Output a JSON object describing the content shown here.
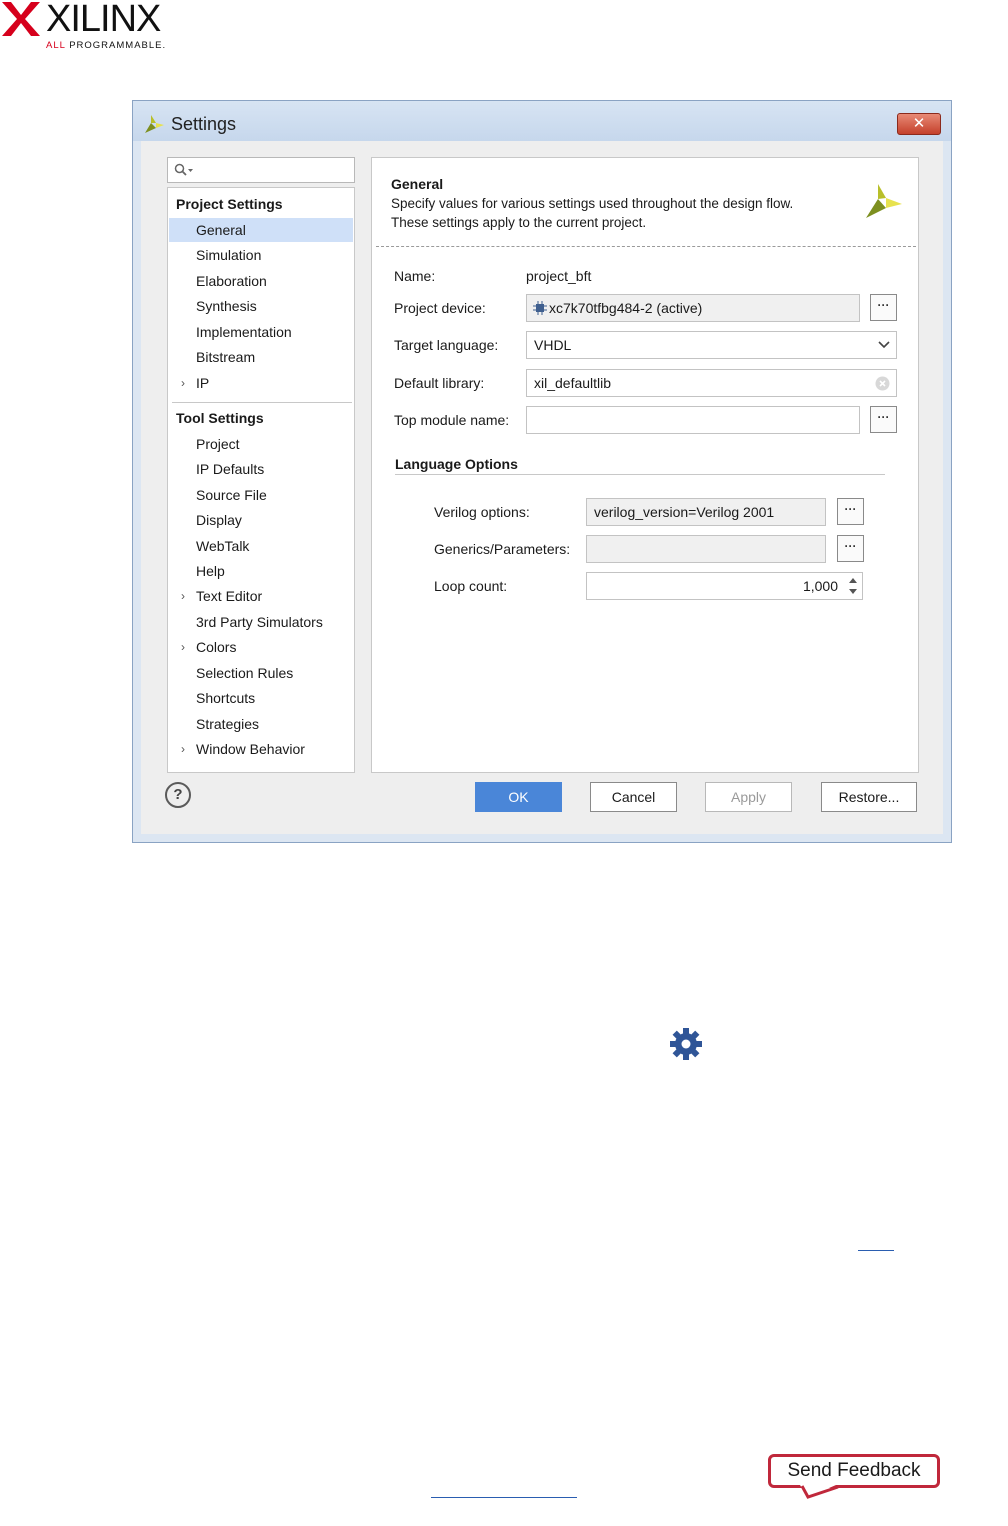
{
  "brand": {
    "name": "XILINX",
    "tagline_highlight": "ALL",
    "tagline_rest": " PROGRAMMABLE."
  },
  "dialog": {
    "title": "Settings",
    "close_glyph": "✕",
    "search_placeholder": "",
    "nav": {
      "project_header": "Project Settings",
      "project_items": [
        {
          "label": "General",
          "selected": true,
          "expandable": false
        },
        {
          "label": "Simulation",
          "selected": false,
          "expandable": false
        },
        {
          "label": "Elaboration",
          "selected": false,
          "expandable": false
        },
        {
          "label": "Synthesis",
          "selected": false,
          "expandable": false
        },
        {
          "label": "Implementation",
          "selected": false,
          "expandable": false
        },
        {
          "label": "Bitstream",
          "selected": false,
          "expandable": false
        },
        {
          "label": "IP",
          "selected": false,
          "expandable": true
        }
      ],
      "tool_header": "Tool Settings",
      "tool_items": [
        {
          "label": "Project",
          "expandable": false
        },
        {
          "label": "IP Defaults",
          "expandable": false
        },
        {
          "label": "Source File",
          "expandable": false
        },
        {
          "label": "Display",
          "expandable": false
        },
        {
          "label": "WebTalk",
          "expandable": false
        },
        {
          "label": "Help",
          "expandable": false
        },
        {
          "label": "Text Editor",
          "expandable": true
        },
        {
          "label": "3rd Party Simulators",
          "expandable": false
        },
        {
          "label": "Colors",
          "expandable": true
        },
        {
          "label": "Selection Rules",
          "expandable": false
        },
        {
          "label": "Shortcuts",
          "expandable": false
        },
        {
          "label": "Strategies",
          "expandable": false
        },
        {
          "label": "Window Behavior",
          "expandable": true
        }
      ]
    },
    "panel": {
      "heading": "General",
      "desc_line1": "Specify values for various settings used throughout the design flow.",
      "desc_line2": "These settings apply to the current project.",
      "name_label": "Name:",
      "name_value": "project_bft",
      "device_label": "Project device:",
      "device_value": "xc7k70tfbg484-2 (active)",
      "language_label": "Target language:",
      "language_value": "VHDL",
      "library_label": "Default library:",
      "library_value": "xil_defaultlib",
      "top_module_label": "Top module name:",
      "top_module_value": "",
      "language_options_heading": "Language Options",
      "verilog_label": "Verilog options:",
      "verilog_value": "verilog_version=Verilog 2001",
      "generics_label": "Generics/Parameters:",
      "generics_value": "",
      "loop_label": "Loop count:",
      "loop_value": "1,000",
      "browse_glyph": "···"
    },
    "buttons": {
      "help": "?",
      "ok": "OK",
      "cancel": "Cancel",
      "apply": "Apply",
      "restore": "Restore..."
    }
  },
  "feedback": {
    "label": "Send Feedback"
  },
  "colors": {
    "selection": "#cfe0f8",
    "ok_button": "#4a86d8",
    "feedback_border": "#c0283b",
    "gear": "#2f5597"
  }
}
